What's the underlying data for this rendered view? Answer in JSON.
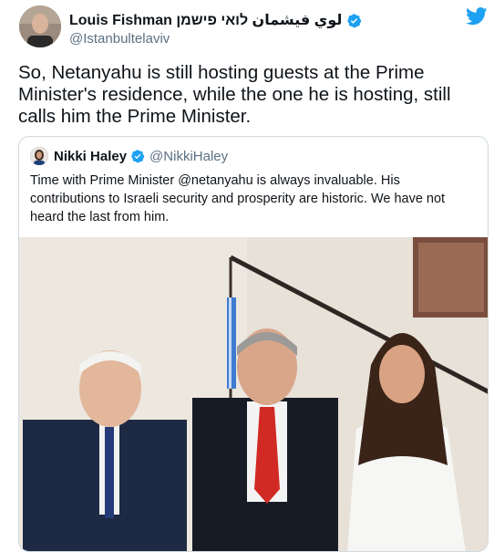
{
  "author": {
    "display_name": "Louis Fishman لوي فيشمان לואי פישמן",
    "handle": "@Istanbultelaviv"
  },
  "tweet": {
    "text": "So, Netanyahu is still hosting guests at the Prime Minister's residence, while the one he is hosting, still calls him the Prime Minister."
  },
  "quoted_tweet": {
    "display_name": "Nikki Haley",
    "handle": "@NikkiHaley",
    "text": "Time with Prime Minister @netanyahu is always invaluable.  His contributions to Israeli security and prosperity are historic. We have not heard the last from him."
  },
  "colors": {
    "twitter_blue": "#1da1f2",
    "secondary_text": "#5b7083",
    "border": "#cfd9de"
  },
  "icons": [
    "verified-badge-icon",
    "twitter-bird-icon"
  ]
}
